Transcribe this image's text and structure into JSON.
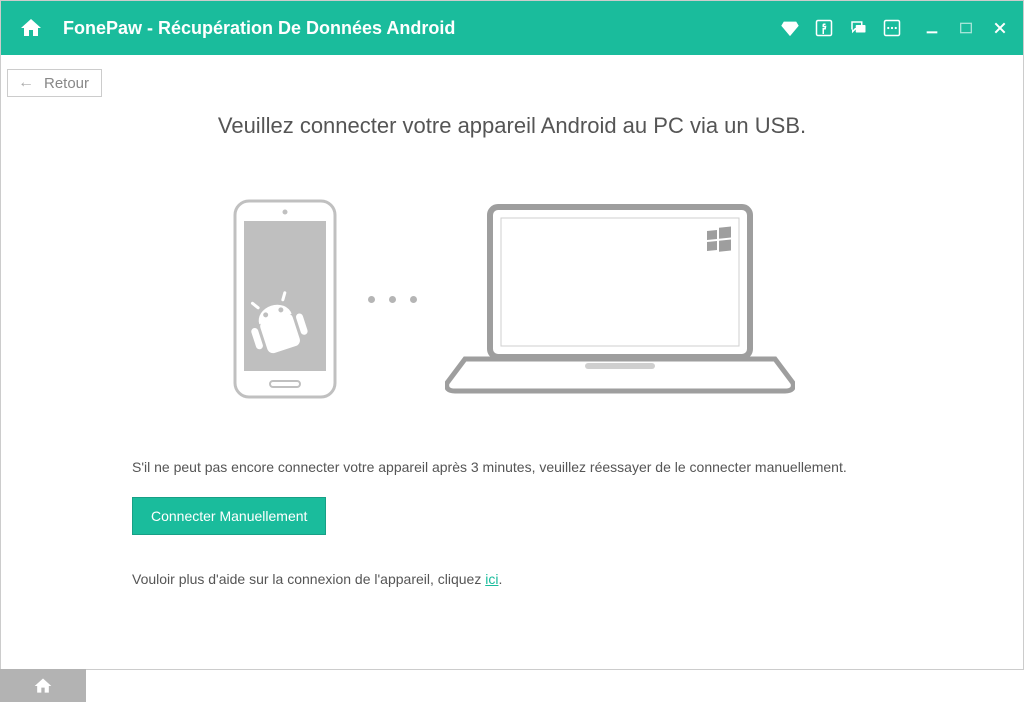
{
  "titlebar": {
    "title": "FonePaw - Récupération De Données Android"
  },
  "back_button": {
    "label": "Retour"
  },
  "main": {
    "instruction": "Veuillez connecter votre appareil Android au PC via un USB.",
    "retry_message": "S'il ne peut pas encore connecter votre appareil après 3 minutes, veuillez réessayer de le connecter manuellement.",
    "connect_button": "Connecter Manuellement",
    "help_prefix": "Vouloir plus d'aide sur la connexion de l'appareil, cliquez ",
    "help_link": "ici",
    "help_suffix": "."
  }
}
